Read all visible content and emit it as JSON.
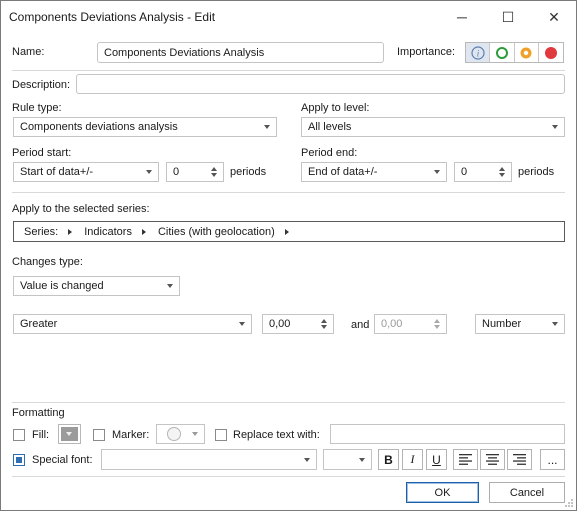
{
  "window": {
    "title": "Components Deviations Analysis - Edit",
    "controls": {
      "minimize": "─",
      "maximize": "☐",
      "close": "✕"
    }
  },
  "name": {
    "label": "Name:",
    "value": "Components Deviations Analysis"
  },
  "importance": {
    "label": "Importance:",
    "levels": [
      "info",
      "green",
      "orange",
      "red"
    ],
    "selected": "info",
    "colors": {
      "info": "#5b7fb3",
      "green": "#2e9b3a",
      "orange": "#f0a12a",
      "red": "#e0393e"
    }
  },
  "description": {
    "label": "Description:",
    "value": ""
  },
  "rule_type": {
    "label": "Rule type:",
    "value": "Components deviations analysis"
  },
  "apply_level": {
    "label": "Apply to level:",
    "value": "All levels"
  },
  "period_start": {
    "label": "Period start:",
    "value": "Start of data+/-",
    "count": "0",
    "unit": "periods"
  },
  "period_end": {
    "label": "Period end:",
    "value": "End of data+/-",
    "count": "0",
    "unit": "periods"
  },
  "series": {
    "label": "Apply to the selected series:",
    "crumbs": [
      "Series:",
      "Indicators",
      "Cities (with geolocation)",
      ""
    ]
  },
  "changes": {
    "label": "Changes type:",
    "value": "Value is changed"
  },
  "condition": {
    "operator": "Greater",
    "from": "0,00",
    "and_label": "and",
    "to": "0,00",
    "type": "Number"
  },
  "formatting": {
    "label": "Formatting",
    "fill_label": "Fill:",
    "marker_label": "Marker:",
    "replace_label": "Replace text with:",
    "replace_value": "",
    "special_font_label": "Special font:",
    "font_name": "",
    "font_size": "",
    "bold": "B",
    "italic": "I",
    "underline": "U",
    "more": "..."
  },
  "buttons": {
    "ok": "OK",
    "cancel": "Cancel"
  },
  "accent": "#2d6fb5"
}
